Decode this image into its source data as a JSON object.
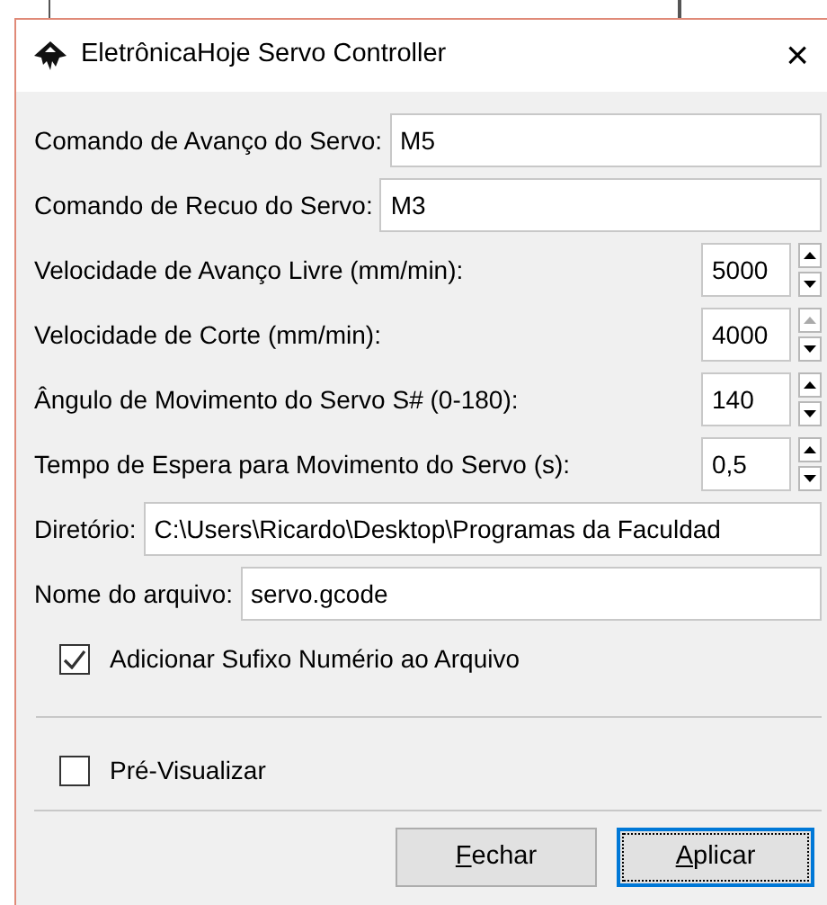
{
  "window": {
    "title": "EletrônicaHoje Servo Controller",
    "close": "×"
  },
  "text_fields": [
    {
      "label": "Comando de Avanço do Servo:",
      "value": "M5"
    },
    {
      "label": "Comando de Recuo do Servo:",
      "value": "M3"
    }
  ],
  "spin_fields": [
    {
      "label": "Velocidade de Avanço Livre (mm/min):",
      "value": "5000",
      "up_disabled": false
    },
    {
      "label": "Velocidade de Corte (mm/min):",
      "value": "4000",
      "up_disabled": true
    },
    {
      "label": "Ângulo de Movimento do Servo S# (0-180):",
      "value": "140",
      "up_disabled": false
    },
    {
      "label": "Tempo de Espera para Movimento do Servo (s):",
      "value": "0,5",
      "up_disabled": false
    }
  ],
  "path_fields": [
    {
      "label": "Diretório:",
      "value": "C:\\Users\\Ricardo\\Desktop\\Programas da Faculdad"
    },
    {
      "label": "Nome do arquivo:",
      "value": "servo.gcode"
    }
  ],
  "suffix_checkbox": {
    "label": "Adicionar Sufixo Numério ao Arquivo",
    "checked": true
  },
  "preview_checkbox": {
    "label": "Pré-Visualizar",
    "checked": false
  },
  "buttons": [
    {
      "mnemonic": "F",
      "rest": "echar",
      "focused": false
    },
    {
      "mnemonic": "A",
      "rest": "plicar",
      "focused": true
    }
  ]
}
